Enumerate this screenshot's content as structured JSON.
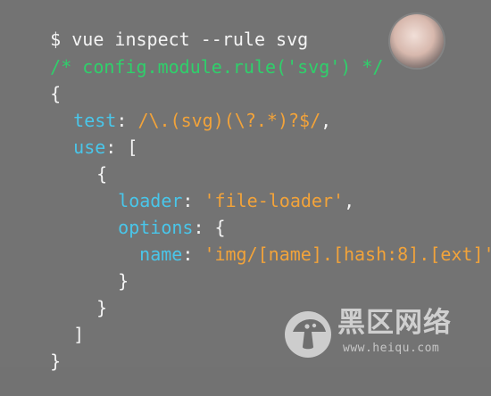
{
  "terminal": {
    "command": "$ vue inspect --rule svg",
    "comment": "/* config.module.rule('svg') */",
    "open_brace": "{",
    "test_key": "test",
    "test_colon": ": ",
    "test_value": "/\\.(svg)(\\?.*)?$/",
    "test_comma": ",",
    "use_key": "use",
    "use_rest": ": [",
    "object_open": "{",
    "loader_key": "loader",
    "loader_colon": ": ",
    "loader_value": "'file-loader'",
    "loader_comma": ",",
    "options_key": "options",
    "options_rest": ": {",
    "name_key": "name",
    "name_colon": ": ",
    "name_value": "'img/[name].[hash:8].[ext]'",
    "options_close": "}",
    "object_close": "}",
    "array_close": "]",
    "close_brace": "}"
  },
  "watermark": {
    "title": "黑区网络",
    "url": "www.heiqu.com"
  },
  "colors": {
    "background": "#737373",
    "text": "#f4f4f4",
    "comment": "#2fd06b",
    "key": "#49c6ea",
    "string": "#f2a33a"
  },
  "icons": {
    "avatar": "user-avatar",
    "watermark_logo": "mushroom-logo-icon"
  }
}
